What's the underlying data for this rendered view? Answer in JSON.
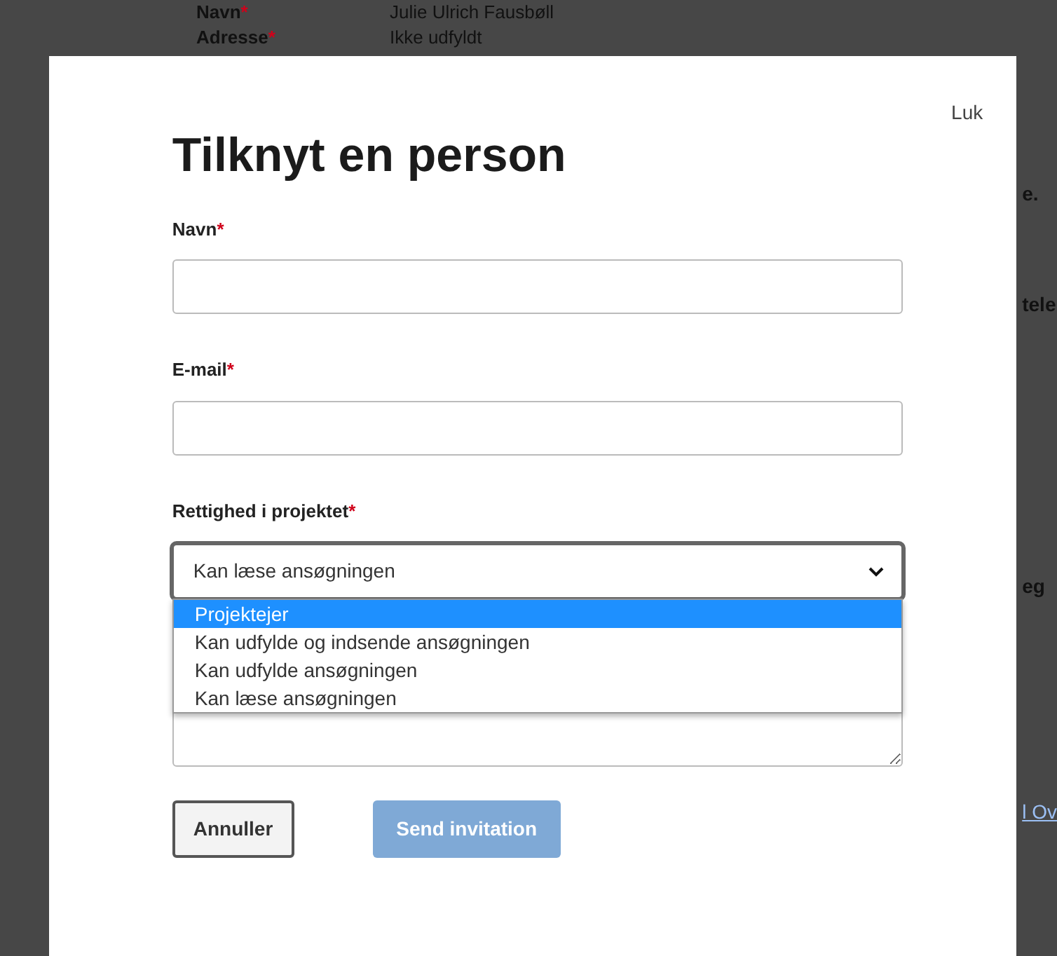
{
  "background": {
    "fields": [
      {
        "label": "Navn",
        "required_mark": "*",
        "value": "Julie Ulrich Fausbøll"
      },
      {
        "label": "Adresse",
        "required_mark": "*",
        "value": "Ikke udfyldt"
      }
    ],
    "edge_texts": [
      {
        "text": "e.",
        "kind": "text"
      },
      {
        "text": "tele",
        "kind": "text"
      },
      {
        "text": "eg",
        "kind": "text"
      },
      {
        "text": "l Ov",
        "kind": "link"
      }
    ]
  },
  "modal": {
    "close": "Luk",
    "title": "Tilknyt en person",
    "fields": [
      {
        "label": "Navn",
        "required_mark": "*",
        "kind": "input"
      },
      {
        "label": "E-mail",
        "required_mark": "*",
        "kind": "input"
      },
      {
        "label": "Rettighed i projektet",
        "required_mark": "*",
        "kind": "select",
        "value": "Kan læse ansøgningen",
        "expanded": true,
        "options": [
          {
            "label": "Projektejer",
            "highlighted": true
          },
          {
            "label": "Kan udfylde og indsende ansøgningen",
            "highlighted": false
          },
          {
            "label": "Kan udfylde ansøgningen",
            "highlighted": false
          },
          {
            "label": "Kan læse ansøgningen",
            "highlighted": false
          }
        ]
      },
      {
        "kind": "textarea"
      }
    ],
    "buttons": [
      {
        "label": "Annuller",
        "disabled": false,
        "kind": "secondary"
      },
      {
        "label": "Send invitation",
        "disabled": true,
        "kind": "primary"
      }
    ]
  }
}
